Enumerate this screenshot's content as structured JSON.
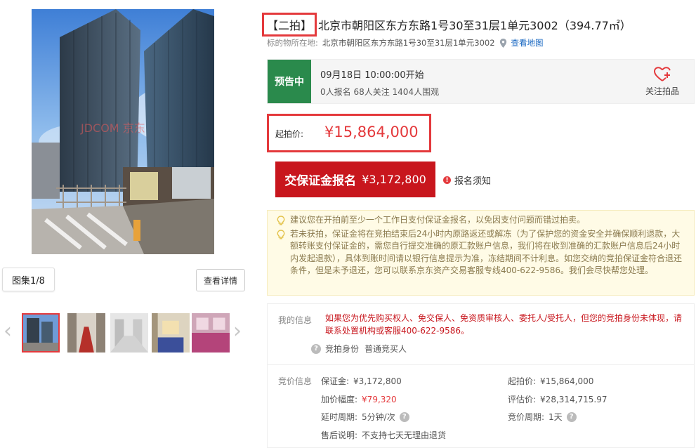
{
  "title": {
    "tag": "【二拍】",
    "text": "北京市朝阳区东方东路1号30至31层1单元3002（394.77㎡）"
  },
  "location": {
    "label": "标的物所在地:",
    "address": "北京市朝阳区东方东路1号30至31层1单元3002",
    "map_link": "查看地图"
  },
  "gallery": {
    "watermark": "JDCOM 京东",
    "album_label": "图集1/8",
    "detail_button": "查看详情",
    "selected_index": 0,
    "thumb_count": 5
  },
  "status": {
    "badge": "预告中",
    "start_time": "09月18日 10:00:00开始",
    "stats": "0人报名  68人关注  1404人围观",
    "follow_label": "关注拍品"
  },
  "price": {
    "label": "起拍价:",
    "value": "¥15,864,000"
  },
  "deposit_button": {
    "label": "交保证金报名",
    "amount": "¥3,172,800"
  },
  "notice_link": "报名须知",
  "tips": [
    "建议您在开拍前至少一个工作日支付保证金报名，以免因支付问题而错过拍卖。",
    "若未获拍，保证金将在竞拍结束后24小时内原路返还或解冻（为了保护您的资金安全并确保顺利退款，大额转账支付保证金的，需您自行提交准确的原汇款账户信息，我们将在收到准确的汇款账户信息后24小时内发起退款），具体到账时间请以银行信息提示为准，冻结期间不计利息。如您交纳的竞拍保证金符合退还条件，但是未予退还，您可以联系京东资产交易客服专线400-622-9586。我们会尽快帮您处理。"
  ],
  "my_info": {
    "label": "我的信息",
    "warning": "如果您为优先购买权人、免交保人、免资质审核人、委托人/受托人，但您的竞拍身份未体现，请联系处置机构或客服400-622-9586。",
    "role_label": "竞拍身份",
    "role_value": "普通竞买人"
  },
  "bid_info": {
    "label": "竞价信息",
    "deposit": {
      "k": "保证金:",
      "v": "¥3,172,800"
    },
    "start_price": {
      "k": "起拍价:",
      "v": "¥15,864,000"
    },
    "increment": {
      "k": "加价幅度:",
      "v": "¥79,320"
    },
    "appraisal": {
      "k": "评估价:",
      "v": "¥28,314,715.97"
    },
    "extension": {
      "k": "延时周期:",
      "v": "5分钟/次"
    },
    "bid_cycle": {
      "k": "竞价周期:",
      "v": "1天"
    },
    "after_sale": {
      "k": "售后说明:",
      "v": "不支持七天无理由退货"
    }
  },
  "colors": {
    "accent_red": "#e4393c",
    "button_red": "#c8161d",
    "status_green": "#2a8a4c",
    "link_blue": "#1565c0",
    "tip_bg": "#fffbe6"
  },
  "icons": [
    "map-pin-icon",
    "heart-plus-icon",
    "bulb-icon",
    "exclamation-icon",
    "question-icon",
    "chevron-left-icon",
    "chevron-right-icon"
  ]
}
